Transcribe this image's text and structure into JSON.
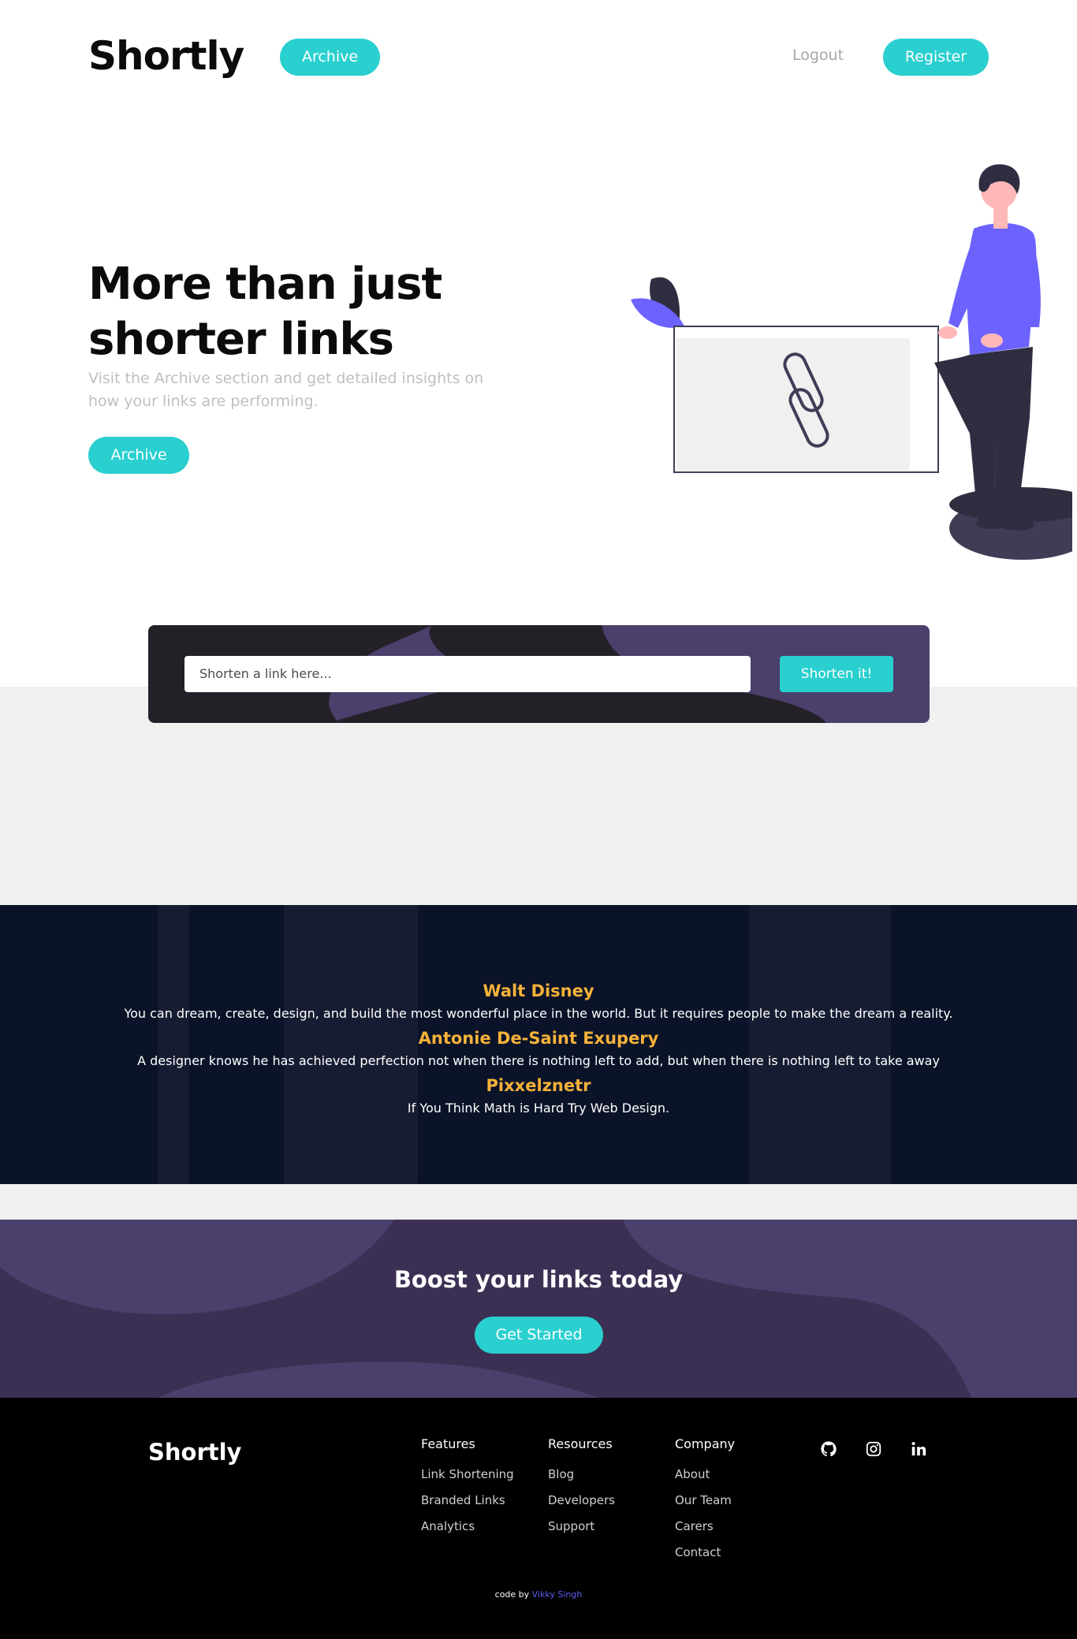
{
  "header": {
    "logo": "Shortly",
    "archive_label": "Archive",
    "logout_label": "Logout",
    "register_label": "Register"
  },
  "hero": {
    "title": "More than just shorter links",
    "subtitle": "Visit the Archive section and get detailed insights on how your links are performing.",
    "archive_label": "Archive"
  },
  "shorten": {
    "placeholder": "Shorten a link here...",
    "button_label": "Shorten it!"
  },
  "quotes": [
    {
      "author": "Walt Disney",
      "text": "You can dream, create, design, and build the most wonderful place in the world. But it requires people to make the dream a reality."
    },
    {
      "author": "Antonie De-Saint Exupery",
      "text": "A designer knows he has achieved perfection not when there is nothing left to add, but when there is nothing left to take away"
    },
    {
      "author": "Pixxelznetr",
      "text": "If You Think Math is Hard Try Web Design."
    }
  ],
  "boost": {
    "title": "Boost your links today",
    "button_label": "Get Started"
  },
  "footer": {
    "logo": "Shortly",
    "columns": [
      {
        "heading": "Features",
        "links": [
          "Link Shortening",
          "Branded Links",
          "Analytics"
        ]
      },
      {
        "heading": "Resources",
        "links": [
          "Blog",
          "Developers",
          "Support"
        ]
      },
      {
        "heading": "Company",
        "links": [
          "About",
          "Our Team",
          "Carers",
          "Contact"
        ]
      }
    ],
    "socials": [
      "github-icon",
      "instagram-icon",
      "linkedin-icon"
    ],
    "credit_prefix": "code by",
    "credit_author": "Vikky Singh"
  },
  "colors": {
    "accent": "#2acfcf",
    "dark_violet": "#3b3054",
    "quote_author": "#f5b23a",
    "illustration_purple": "#6c63ff"
  }
}
